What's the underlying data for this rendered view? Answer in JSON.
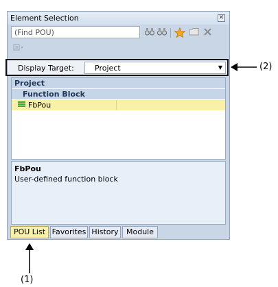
{
  "window": {
    "title": "Element Selection",
    "close_glyph": "✕"
  },
  "search": {
    "value": "(Find POU)"
  },
  "toolbar": {
    "icons": [
      "binoculars-icon",
      "binoculars-icon",
      "star-icon",
      "folder-icon",
      "delete-icon"
    ]
  },
  "display_target": {
    "label": "Display Target:",
    "value": "Project"
  },
  "tree": {
    "project_label": "Project",
    "group_label": "Function Block",
    "item_label": "FbPou"
  },
  "description": {
    "name": "FbPou",
    "text": "User-defined function block"
  },
  "tabs": [
    {
      "label": "POU List",
      "active": true
    },
    {
      "label": "Favorites",
      "active": false
    },
    {
      "label": "History",
      "active": false
    },
    {
      "label": "Module",
      "active": false
    }
  ],
  "callouts": {
    "one": "(1)",
    "two": "(2)"
  },
  "colors": {
    "selected_row": "#fbf0a8",
    "header_row": "#c6d5e8",
    "panel": "#c9d6e6"
  }
}
